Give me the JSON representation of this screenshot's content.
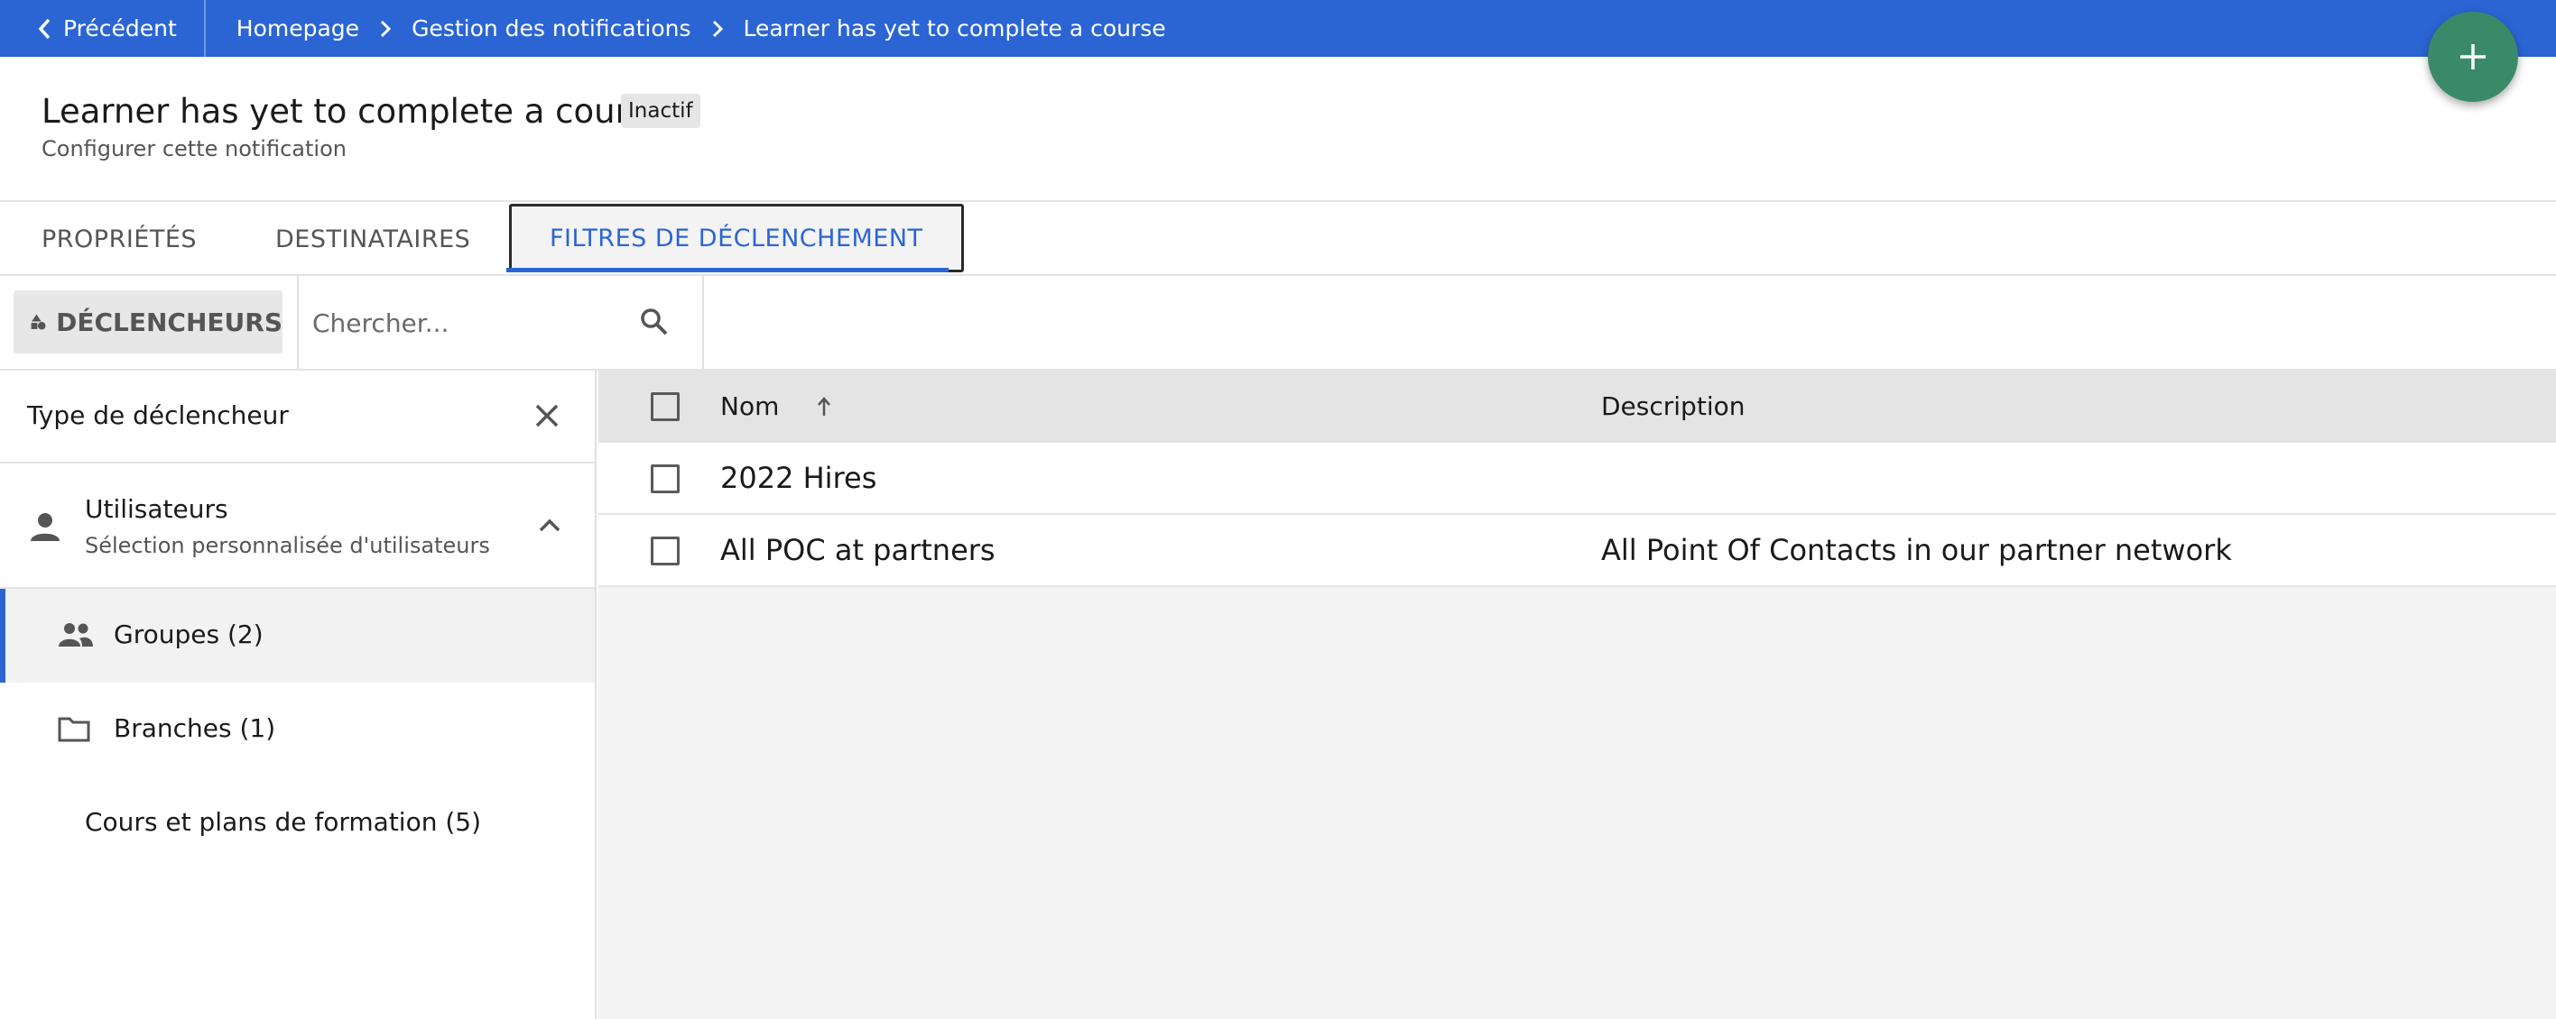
{
  "topbar": {
    "back_label": "Précédent",
    "breadcrumbs": [
      "Homepage",
      "Gestion des notifications",
      "Learner has yet to complete a course"
    ]
  },
  "header": {
    "title": "Learner has yet to complete a course",
    "status_badge": "Inactif",
    "subtitle": "Configurer cette notification"
  },
  "tabs": [
    {
      "label": "PROPRIÉTÉS"
    },
    {
      "label": "DESTINATAIRES"
    },
    {
      "label": "FILTRES DE DÉCLENCHEMENT",
      "active": true
    }
  ],
  "toolbar": {
    "triggers_label": "DÉCLENCHEURS",
    "search_placeholder": "Chercher..."
  },
  "filter_panel": {
    "title": "Type de déclencheur",
    "users": {
      "label": "Utilisateurs",
      "description": "Sélection personnalisée d'utilisateurs"
    },
    "items": [
      {
        "label": "Groupes (2)",
        "icon": "group-icon",
        "selected": true
      },
      {
        "label": "Branches (1)",
        "icon": "folder-icon"
      },
      {
        "label": "Cours et plans de formation (5)"
      }
    ]
  },
  "table": {
    "columns": [
      "Nom",
      "Description"
    ],
    "rows": [
      {
        "name": "2022 Hires",
        "description": ""
      },
      {
        "name": "All POC at partners",
        "description": "All Point Of Contacts in our partner network"
      }
    ]
  },
  "colors": {
    "primary": "#2b65d4",
    "fab": "#3a8a6a"
  }
}
